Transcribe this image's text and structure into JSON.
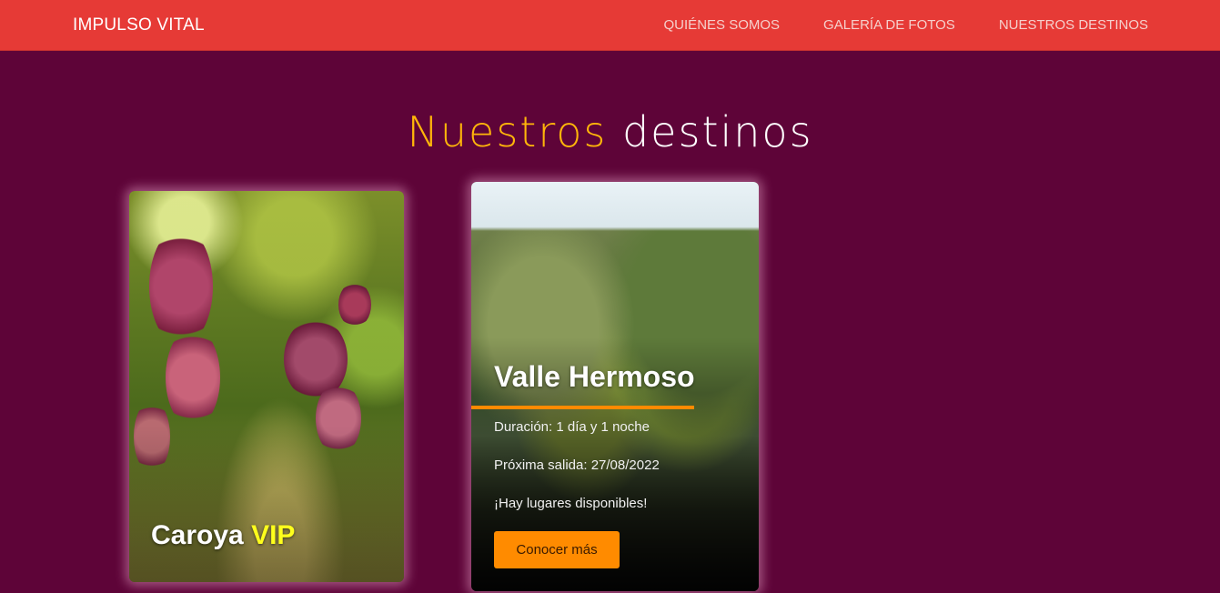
{
  "nav": {
    "brand": "IMPULSO VITAL",
    "links": [
      "QUIÉNES SOMOS",
      "GALERÍA DE FOTOS",
      "NUESTROS DESTINOS"
    ]
  },
  "title": {
    "accent": "Nuestros",
    "rest": "destinos"
  },
  "cards": {
    "caroya": {
      "name": "Caroya",
      "tag": "VIP"
    },
    "valle": {
      "name": "Valle Hermoso",
      "duration": "Duración: 1 día y 1 noche",
      "departure": "Próxima salida: 27/08/2022",
      "availability": "¡Hay lugares disponibles!",
      "button": "Conocer más"
    }
  },
  "colors": {
    "navbar": "#e63a36",
    "background": "#5e0438",
    "accent": "#ffb60a",
    "button": "#ff8b00",
    "vip": "#ffff1c"
  }
}
